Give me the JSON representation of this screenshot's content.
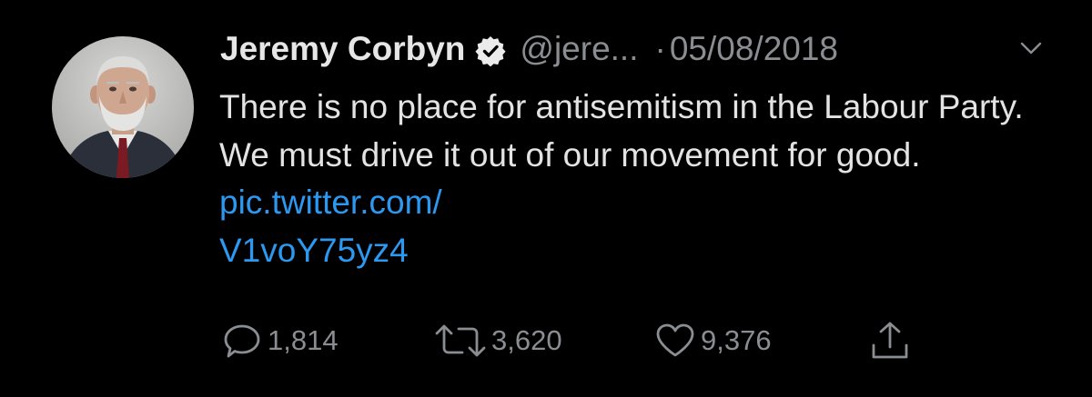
{
  "tweet": {
    "author_name": "Jeremy Corbyn",
    "handle": "@jere...",
    "separator": "·",
    "date": "05/08/2018",
    "text_before_link": "There is no place for antisemitism in the Labour Party. We must drive it out of our movement for good. ",
    "link_line1": "pic.twitter.com/",
    "link_line2": "V1voY75yz4"
  },
  "actions": {
    "replies": "1,814",
    "retweets": "3,620",
    "likes": "9,376"
  },
  "icons": {
    "verified": "verified-badge-icon",
    "menu": "chevron-down-icon",
    "reply": "reply-icon",
    "retweet": "retweet-icon",
    "like": "heart-icon",
    "share": "share-icon"
  },
  "colors": {
    "background": "#000000",
    "text": "#e3e3e3",
    "muted": "#8a8d91",
    "link": "#2c98f0"
  }
}
